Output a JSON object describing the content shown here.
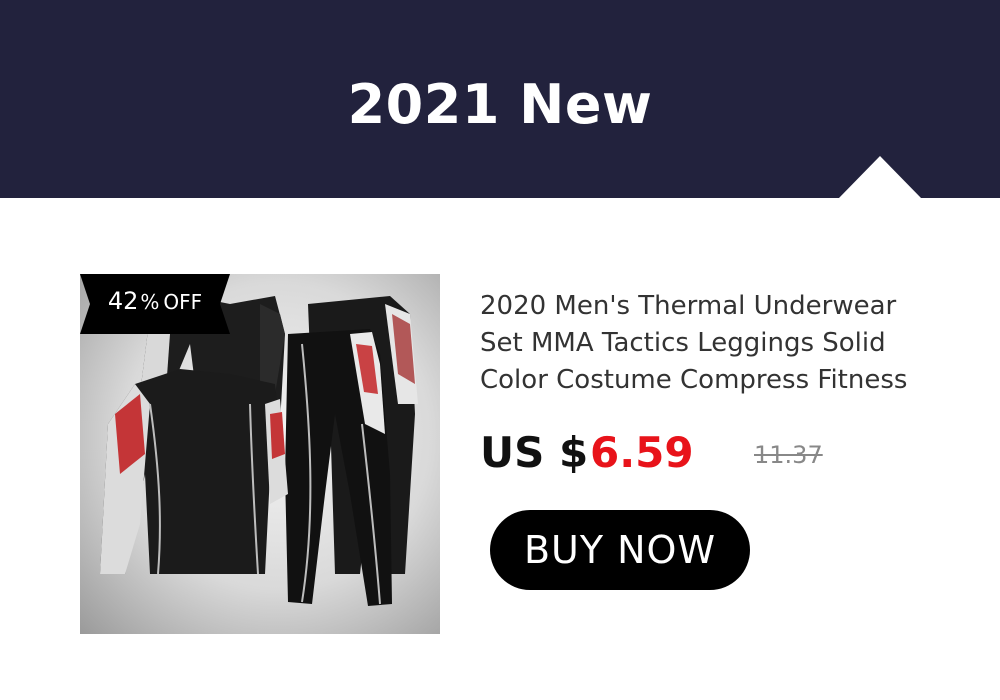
{
  "banner": {
    "title": "2021 New",
    "background_color": "#22223d"
  },
  "product": {
    "image_icon": "thermal-underwear-set-photo",
    "badge": {
      "percent": "42",
      "percent_sign": "%",
      "off_label": "OFF"
    },
    "title": "2020 Men's Thermal Underwear Set MMA Tactics Leggings Solid Color Costume Compress Fitness",
    "currency_label": "US $",
    "sale_price": "6.59",
    "original_price": "11.37",
    "sale_color": "#e8131a"
  },
  "cta": {
    "label": "BUY NOW"
  }
}
